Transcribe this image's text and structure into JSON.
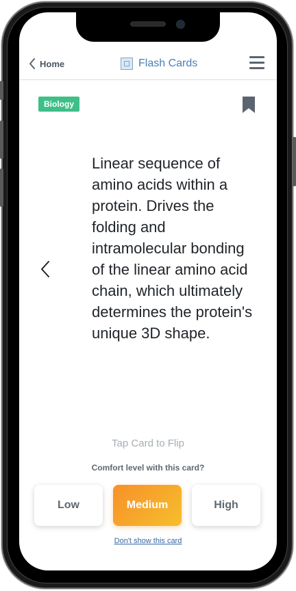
{
  "header": {
    "back_label": "Home",
    "title": "Flash Cards"
  },
  "card": {
    "tag": "Biology",
    "text": "Linear sequence of amino acids within a protein. Drives the folding and intramolecular bonding of the linear amino acid chain, which ultimately determines the protein's unique 3D shape."
  },
  "hint": "Tap Card to Flip",
  "comfort": {
    "question": "Comfort level with this card?",
    "options": [
      "Low",
      "Medium",
      "High"
    ],
    "selected": "Medium"
  },
  "skip_label": "Don't show this card",
  "colors": {
    "tag": "#3fbf88",
    "accent_title": "#4a7fb5",
    "selected_gradient_start": "#f7902a",
    "selected_gradient_end": "#f6bf2c",
    "link": "#3569a8"
  },
  "icons": {
    "back": "chevron-left-icon",
    "app": "flash-card-icon",
    "menu": "hamburger-menu-icon",
    "bookmark": "bookmark-icon",
    "prev": "chevron-left-icon"
  }
}
